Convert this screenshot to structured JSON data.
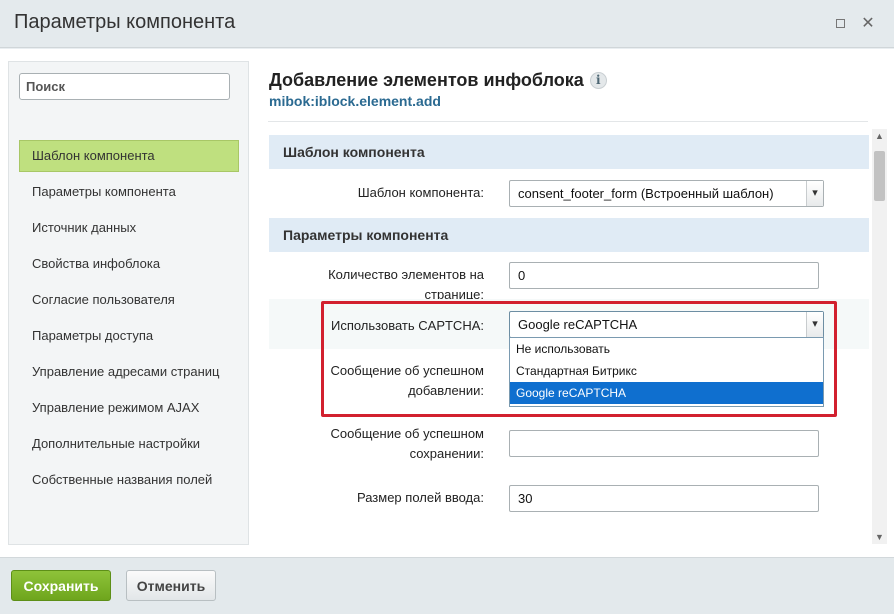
{
  "window": {
    "title": "Параметры компонента",
    "maximize_icon": "maximize-icon",
    "close_icon": "close-icon",
    "close_glyph": "✕"
  },
  "sidebar": {
    "search_placeholder": "Поиск",
    "items": [
      {
        "label": "Шаблон компонента",
        "active": true
      },
      {
        "label": "Параметры компонента"
      },
      {
        "label": "Источник данных"
      },
      {
        "label": "Свойства инфоблока"
      },
      {
        "label": "Согласие пользователя"
      },
      {
        "label": "Параметры доступа"
      },
      {
        "label": "Управление адресами страниц"
      },
      {
        "label": "Управление режимом AJAX"
      },
      {
        "label": "Дополнительные настройки"
      },
      {
        "label": "Собственные названия полей"
      }
    ]
  },
  "main": {
    "title": "Добавление элементов инфоблока",
    "info_glyph": "i",
    "component_code": "mibok:iblock.element.add",
    "sections": [
      {
        "title": "Шаблон компонента"
      },
      {
        "title": "Параметры компонента"
      }
    ],
    "template_field": {
      "label": "Шаблон компонента:",
      "value": "consent_footer_form (Встроенный шаблон)"
    },
    "elements_count": {
      "label": "Количество элементов на странице:",
      "value": "0"
    },
    "captcha": {
      "label": "Использовать CAPTCHA:",
      "value": "Google reCAPTCHA",
      "options": [
        {
          "label": "Не использовать"
        },
        {
          "label": "Стандартная Битрикс"
        },
        {
          "label": "Google reCAPTCHA",
          "selected": true
        }
      ]
    },
    "success_add": {
      "label_line1": "Сообщение об успешном",
      "label_line2": "добавлении:"
    },
    "success_save": {
      "label_line1": "Сообщение об успешном",
      "label_line2": "сохранении:",
      "value": ""
    },
    "input_size": {
      "label": "Размер полей ввода:",
      "value": "30"
    }
  },
  "footer": {
    "save_label": "Сохранить",
    "cancel_label": "Отменить"
  },
  "colors": {
    "active_nav": "#bfe07f",
    "section_header": "#e0ebf5",
    "highlight_border": "#d2202f",
    "dropdown_selected": "#0f6fcf",
    "save_button": "#7ab32a",
    "link_blue": "#2b6a91"
  }
}
